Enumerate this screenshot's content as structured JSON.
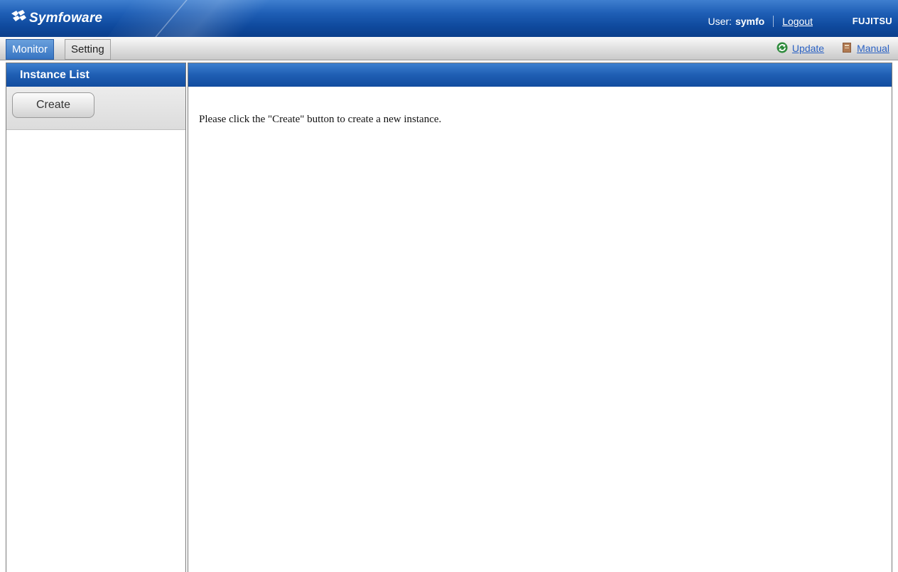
{
  "header": {
    "app_name": "Symfoware",
    "user_label": "User:",
    "user_name": "symfo",
    "logout_label": "Logout",
    "brand": "FUJITSU",
    "colors": {
      "header_blue": "#1f5fb6",
      "link_blue": "#2b62c4"
    }
  },
  "menu": {
    "tabs": [
      {
        "label": "Monitor",
        "active": true
      },
      {
        "label": "Setting",
        "active": false
      }
    ],
    "update_label": "Update",
    "update_icon": "refresh-icon",
    "manual_label": "Manual",
    "manual_icon": "book-icon"
  },
  "sidebar": {
    "title": "Instance List",
    "create_label": "Create"
  },
  "main": {
    "message": "Please click the \"Create\" button to create a new instance."
  }
}
